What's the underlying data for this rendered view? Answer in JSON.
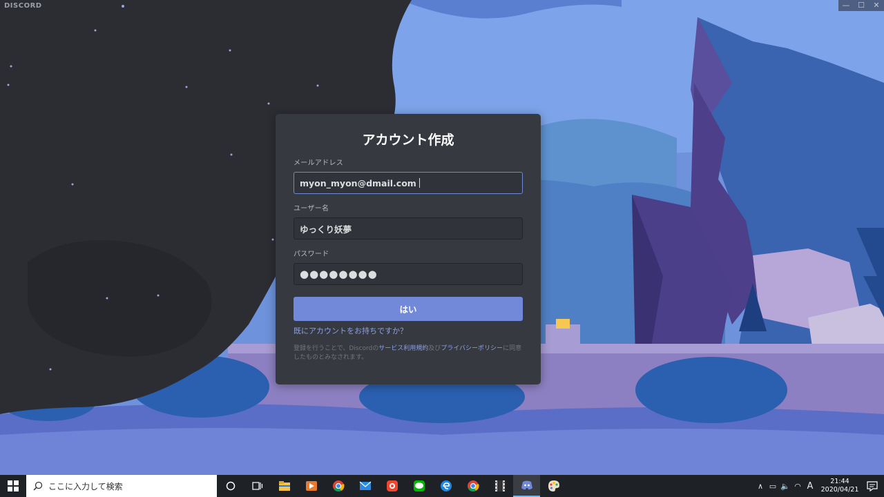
{
  "window": {
    "brand": "DISCORD",
    "minimize": "—",
    "maximize": "☐",
    "close": "✕"
  },
  "register": {
    "title": "アカウント作成",
    "email_label": "メールアドレス",
    "email_value": "myon_myon@dmail.com",
    "username_label": "ユーザー名",
    "username_value": "ゆっくり妖夢",
    "password_label": "パスワード",
    "password_value": "●●●●●●●●",
    "submit_label": "はい",
    "login_link": "既にアカウントをお持ちですか？",
    "terms_prefix": "登録を行うことで、Discordの",
    "terms_tos": "サービス利用規約",
    "terms_and": "及び",
    "terms_privacy": "プライバシーポリシー",
    "terms_suffix": "に同意したものとみなされます。",
    "accent_color": "#7289da"
  },
  "taskbar": {
    "search_placeholder": "ここに入力して検索",
    "cortana": "○",
    "task_view": "⧉",
    "apps": [
      "file-explorer-icon",
      "media-player-icon",
      "chrome-icon",
      "mail-icon",
      "camera-app-icon",
      "line-icon",
      "edge-icon",
      "chrome-icon",
      "film-icon",
      "discord-icon",
      "paint-icon"
    ],
    "tray": {
      "chevron": "∧",
      "battery": "▭",
      "volume": "🔈",
      "wifi": "◠",
      "ime": "A",
      "time": "21:44",
      "date": "2020/04/21"
    }
  }
}
